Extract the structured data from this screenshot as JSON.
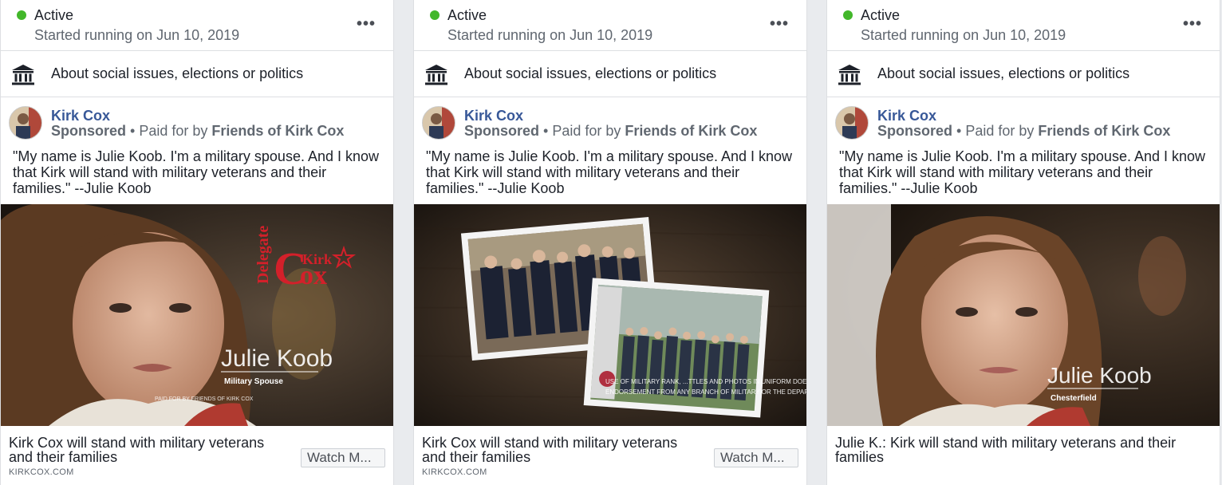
{
  "colors": {
    "active_green": "#42b72a",
    "link_blue": "#385898",
    "gray_text": "#606770"
  },
  "cards": [
    {
      "status": "Active",
      "started": "Started running on Jun 10, 2019",
      "more": "•••",
      "category": "About social issues, elections or politics",
      "page_name": "Kirk Cox",
      "sponsored": "Sponsored",
      "sep": " • Paid for by ",
      "payer": "Friends of Kirk Cox",
      "body": "\"My name is Julie Koob. I'm a military spouse. And I know that Kirk will stand with military veterans and their families.\" --Julie Koob",
      "video": {
        "name": "Julie Koob",
        "sub": "Military Spouse",
        "logo_delegate": "Delegate",
        "logo_kirk": "Kirk",
        "logo_cox": "Cox",
        "paid": "PAID FOR BY FRIENDS OF KIRK COX"
      },
      "footer_title": "Kirk Cox will stand with military veterans and their families",
      "domain": "KIRKCOX.COM",
      "cta": "Watch M..."
    },
    {
      "status": "Active",
      "started": "Started running on Jun 10, 2019",
      "more": "•••",
      "category": "About social issues, elections or politics",
      "page_name": "Kirk Cox",
      "sponsored": "Sponsored",
      "sep": " • Paid for by ",
      "payer": "Friends of Kirk Cox",
      "body": "\"My name is Julie Koob. I'm a military spouse. And I know that Kirk will stand with military veterans and their families.\" --Julie Koob",
      "video": {
        "disclaimer_1": "USE OF MILITARY RANK, ...TTLES AND PHOTOS IN UNIFORM DOES NOT IMPLY",
        "disclaimer_2": "ENDORSEMENT FROM ANY BRANCH OF MILITARY OR THE DEPARTMENT OF DEFENSE"
      },
      "footer_title": "Kirk Cox will stand with military veterans and their families",
      "domain": "KIRKCOX.COM",
      "cta": "Watch M..."
    },
    {
      "status": "Active",
      "started": "Started running on Jun 10, 2019",
      "more": "•••",
      "category": "About social issues, elections or politics",
      "page_name": "Kirk Cox",
      "sponsored": "Sponsored",
      "sep": " • Paid for by ",
      "payer": "Friends of Kirk Cox",
      "body": "\"My name is Julie Koob. I'm a military spouse. And I know that Kirk will stand with military veterans and their families.\" --Julie Koob",
      "video": {
        "name": "Julie Koob",
        "sub": "Chesterfield"
      },
      "footer_title": "Julie K.: Kirk will stand with military veterans and their families"
    }
  ]
}
